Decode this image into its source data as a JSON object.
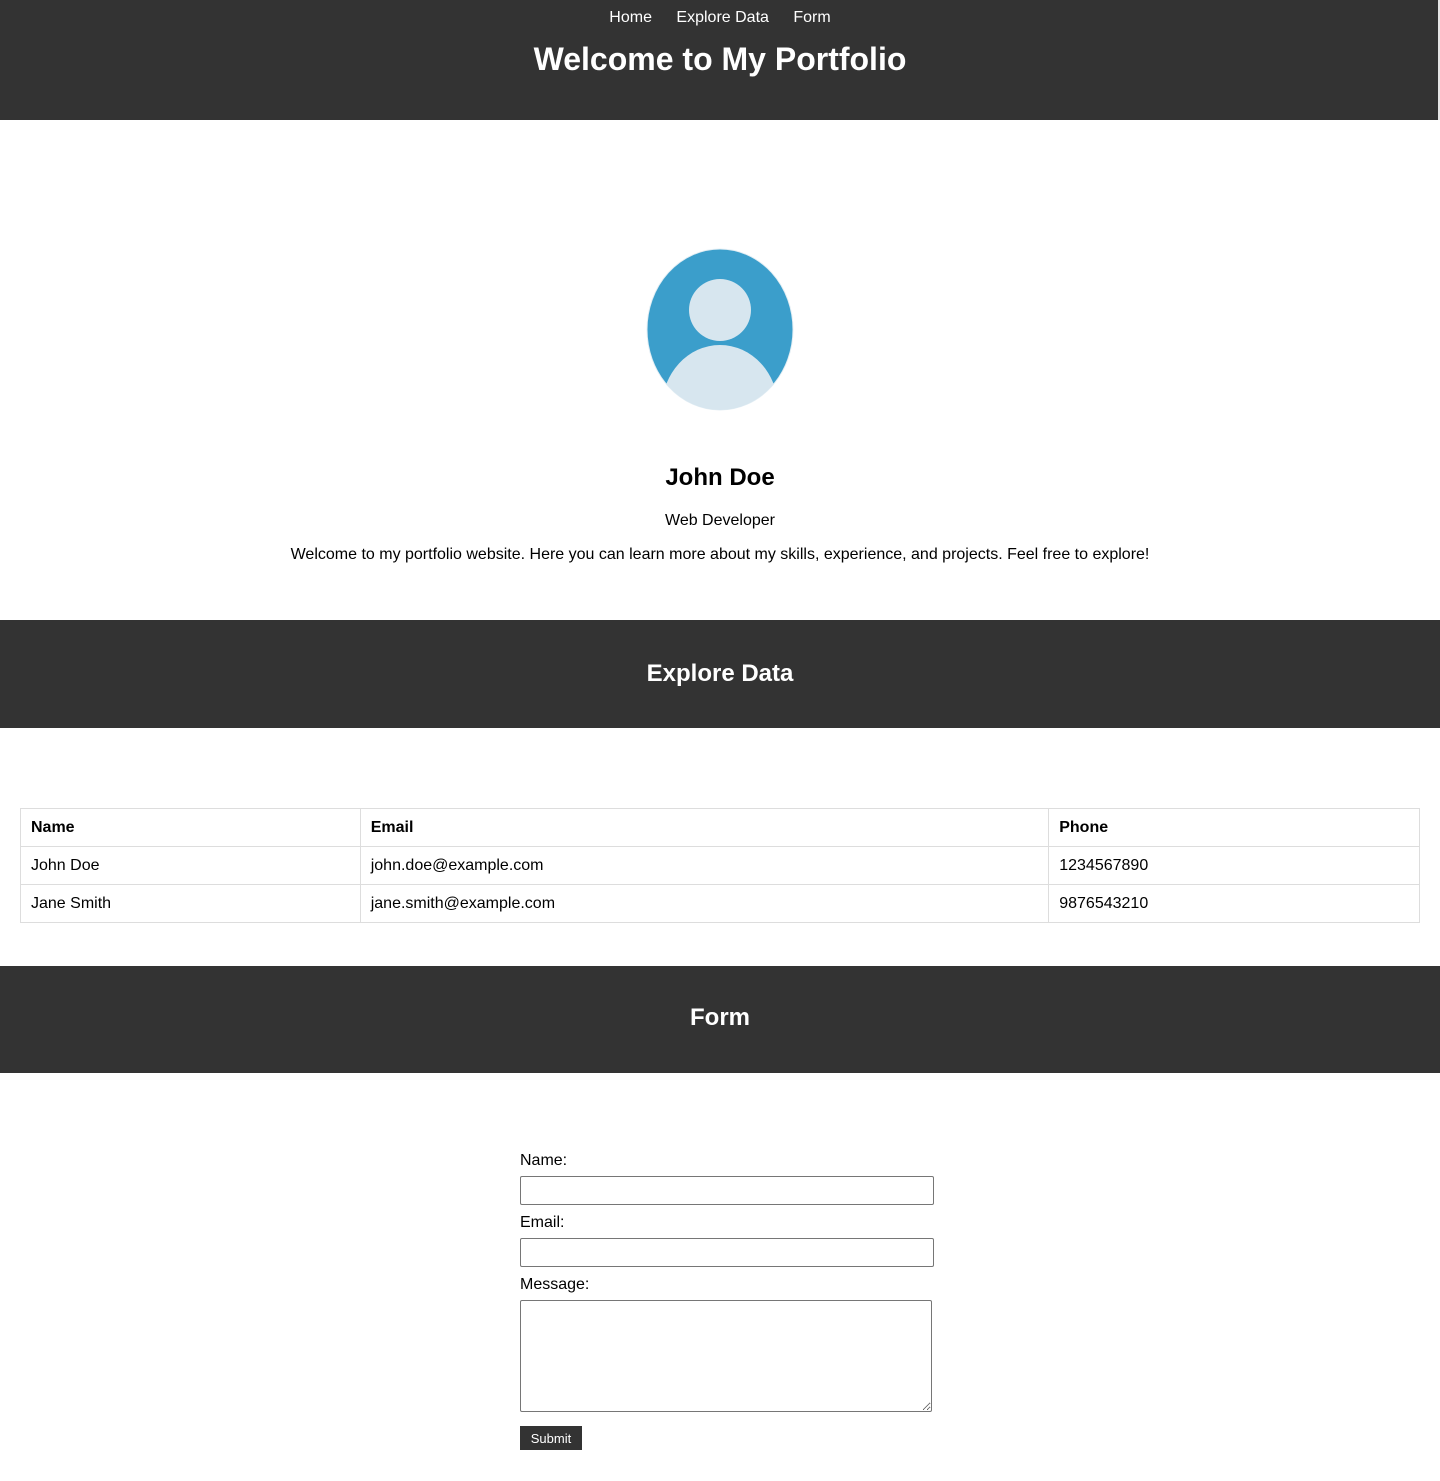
{
  "nav": {
    "items": [
      {
        "label": "Home"
      },
      {
        "label": "Explore Data"
      },
      {
        "label": "Form"
      }
    ]
  },
  "header": {
    "title": "Welcome to My Portfolio"
  },
  "profile": {
    "name": "John Doe",
    "role": "Web Developer",
    "intro": "Welcome to my portfolio website. Here you can learn more about my skills, experience, and projects. Feel free to explore!"
  },
  "data_section": {
    "title": "Explore Data",
    "columns": [
      "Name",
      "Email",
      "Phone"
    ],
    "rows": [
      [
        "John Doe",
        "john.doe@example.com",
        "1234567890"
      ],
      [
        "Jane Smith",
        "jane.smith@example.com",
        "9876543210"
      ]
    ]
  },
  "form_section": {
    "title": "Form",
    "name_label": "Name:",
    "name_value": "",
    "email_label": "Email:",
    "email_value": "",
    "message_label": "Message:",
    "message_value": "",
    "submit_label": "Submit"
  },
  "colors": {
    "header_bg": "#333333",
    "avatar_bg": "#3b9ecb",
    "avatar_fg": "#d7e6ef",
    "table_border": "#dddddd"
  },
  "icons": {
    "avatar": "user-avatar-icon"
  }
}
